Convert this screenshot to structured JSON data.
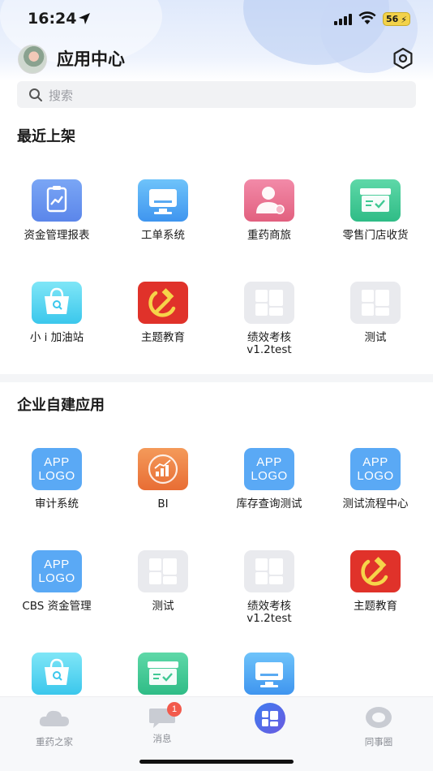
{
  "status_bar": {
    "time": "16:24",
    "battery": "56"
  },
  "header": {
    "title": "应用中心"
  },
  "search": {
    "placeholder": "搜索"
  },
  "sections": [
    {
      "title": "最近上架",
      "apps": [
        {
          "label": "资金管理报表",
          "icon": "chart-report-icon",
          "color": "#6a96ef"
        },
        {
          "label": "工单系统",
          "icon": "monitor-icon",
          "color": "#4aa5f2"
        },
        {
          "label": "重药商旅",
          "icon": "user-service-icon",
          "color": "#ea7091"
        },
        {
          "label": "零售门店收货",
          "icon": "receipt-check-icon",
          "color": "#3fc893"
        },
        {
          "label": "小 i 加油站",
          "icon": "shopping-bag-icon",
          "color": "#56d4f1"
        },
        {
          "label": "主题教育",
          "icon": "hammer-sickle-icon",
          "color": "#e0322a"
        },
        {
          "label": "绩效考核\nv1.2test",
          "icon": "grid-placeholder-icon",
          "color": "#e9eaee"
        },
        {
          "label": "测试",
          "icon": "grid-placeholder-icon",
          "color": "#e9eaee"
        }
      ]
    },
    {
      "title": "企业自建应用",
      "apps": [
        {
          "label": "审计系统",
          "icon": "app-logo-icon",
          "logo_text": [
            "APP",
            "LOGO"
          ],
          "color": "#5aa9f5"
        },
        {
          "label": "BI",
          "icon": "bi-chart-icon",
          "color": "#ee7e43"
        },
        {
          "label": "库存查询测试",
          "icon": "app-logo-icon",
          "logo_text": [
            "APP",
            "LOGO"
          ],
          "color": "#5aa9f5"
        },
        {
          "label": "测试流程中心",
          "icon": "app-logo-icon",
          "logo_text": [
            "APP",
            "LOGO"
          ],
          "color": "#5aa9f5"
        },
        {
          "label": "CBS 资金管理",
          "icon": "app-logo-icon",
          "logo_text": [
            "APP",
            "LOGO"
          ],
          "color": "#5aa9f5"
        },
        {
          "label": "测试",
          "icon": "grid-placeholder-icon",
          "color": "#e9eaee"
        },
        {
          "label": "绩效考核\nv1.2test",
          "icon": "grid-placeholder-icon",
          "color": "#e9eaee"
        },
        {
          "label": "主题教育",
          "icon": "hammer-sickle-icon",
          "color": "#e0322a"
        },
        {
          "label": "",
          "icon": "shopping-bag-icon",
          "color": "#56d4f1"
        },
        {
          "label": "",
          "icon": "receipt-check-icon",
          "color": "#3fc893"
        },
        {
          "label": "",
          "icon": "monitor-icon",
          "color": "#4aa5f2"
        }
      ]
    }
  ],
  "tabbar": {
    "tabs": [
      {
        "label": "重药之家",
        "icon": "cloud-icon",
        "active": false
      },
      {
        "label": "消息",
        "icon": "message-icon",
        "badge": "1",
        "active": false
      },
      {
        "label": "",
        "icon": "app-center-icon",
        "active": true
      },
      {
        "label": "同事圈",
        "icon": "circle-icon",
        "active": false
      }
    ]
  },
  "colors": {
    "accent": "#4a6fdc",
    "badge": "#f25a4c"
  }
}
